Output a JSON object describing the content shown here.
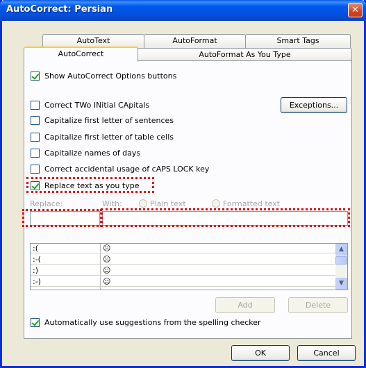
{
  "window": {
    "title": "AutoCorrect: Persian",
    "close_glyph": "✕"
  },
  "tabs": {
    "back": [
      "AutoText",
      "AutoFormat",
      "Smart Tags"
    ],
    "front": [
      "AutoCorrect",
      "AutoFormat As You Type"
    ]
  },
  "options": {
    "show_buttons": "Show AutoCorrect Options buttons",
    "two_initial": "Correct TWo INitial CApitals",
    "first_letter_sentences": "Capitalize first letter of sentences",
    "first_letter_cells": "Capitalize first letter of table cells",
    "names_of_days": "Capitalize names of days",
    "caps_lock": "Correct accidental usage of cAPS LOCK key",
    "replace_text": "Replace text as you type",
    "spelling_suggestions": "Automatically use suggestions from the spelling checker"
  },
  "checked": {
    "show_buttons": true,
    "two_initial": false,
    "first_letter_sentences": false,
    "first_letter_cells": false,
    "names_of_days": false,
    "caps_lock": false,
    "replace_text": true,
    "spelling_suggestions": true
  },
  "exceptions_button": "Exceptions...",
  "replace_section": {
    "replace_label": "Replace:",
    "with_label": "With:",
    "plain_text": "Plain text",
    "formatted_text": "Formatted text",
    "replace_value": "",
    "with_value": ""
  },
  "list": {
    "rows": [
      {
        "replace": ":(",
        "with": "☹"
      },
      {
        "replace": ":-(",
        "with": "☹"
      },
      {
        "replace": ":)",
        "with": "☺"
      },
      {
        "replace": ":-)",
        "with": "☺"
      }
    ]
  },
  "buttons": {
    "add": "Add",
    "delete": "Delete",
    "ok": "OK",
    "cancel": "Cancel"
  },
  "colors": {
    "highlight": "#e00000",
    "titlebar": "#0058ee",
    "dialog_bg": "#ece9d8"
  }
}
